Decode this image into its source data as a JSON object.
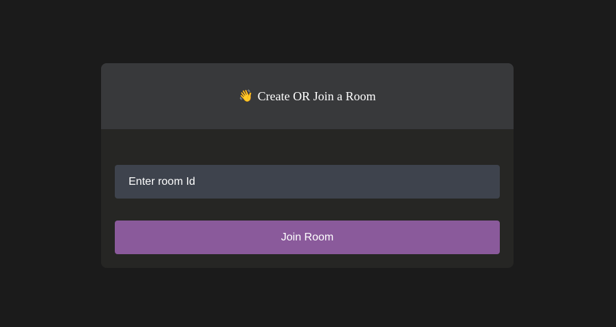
{
  "card": {
    "title_icon": "👋",
    "title_icon_name": "waving-hand-icon",
    "title": "Create OR Join a Room"
  },
  "form": {
    "room_id_placeholder": "Enter room Id",
    "room_id_value": "",
    "join_button_label": "Join Room"
  },
  "colors": {
    "page_background": "#1b1b1b",
    "card_header": "#38393b",
    "card_body": "#262624",
    "input_background": "#3e434d",
    "button_background": "#8a5a9b",
    "text": "#ffffff"
  }
}
